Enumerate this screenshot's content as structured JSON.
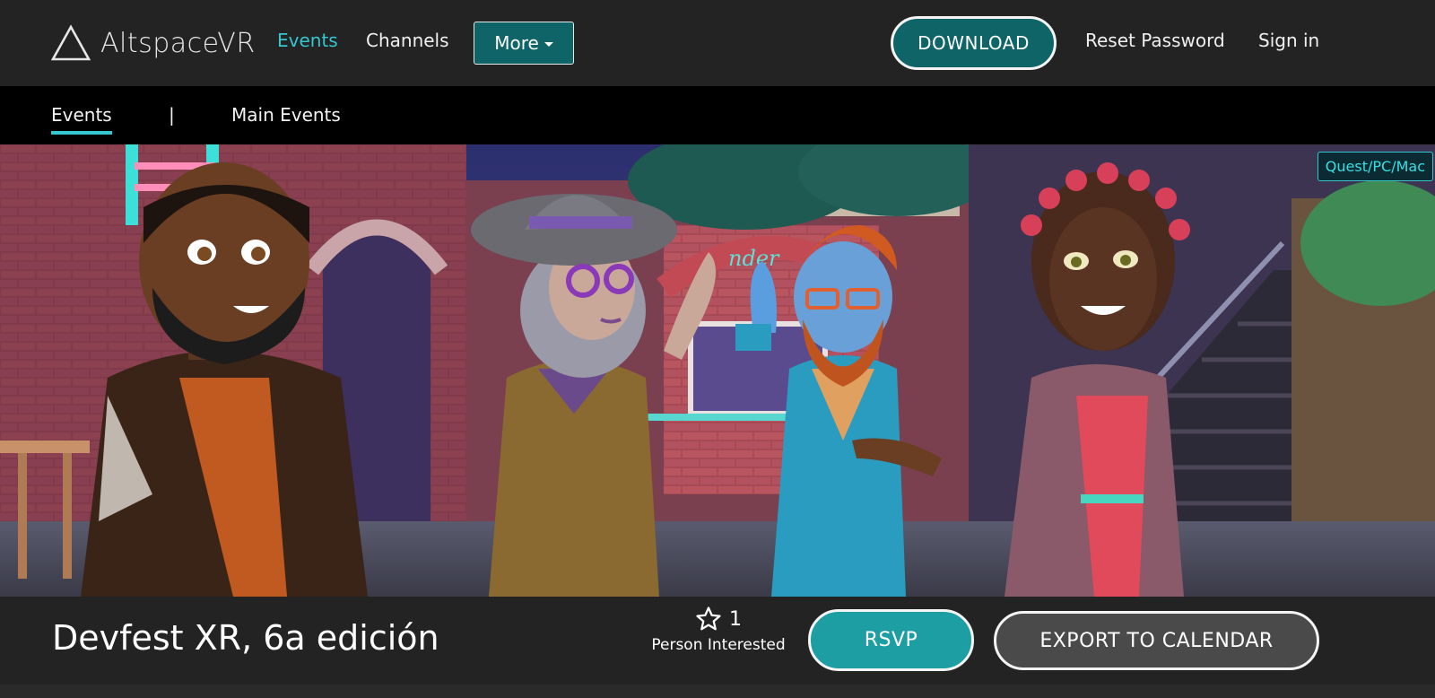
{
  "header": {
    "logo_text": "AltspaceVR",
    "nav": {
      "events": "Events",
      "channels": "Channels",
      "more": "More"
    },
    "download": "DOWNLOAD",
    "reset_password": "Reset Password",
    "sign_in": "Sign in"
  },
  "subnav": {
    "events": "Events",
    "separator": "|",
    "main_events": "Main Events"
  },
  "hero": {
    "platform_badge": "Quest/PC/Mac",
    "sign_text": "nder"
  },
  "event": {
    "title": "Devfest XR, 6a edición",
    "interested_count": "1",
    "interested_label": "Person Interested",
    "rsvp": "RSVP",
    "export": "EXPORT TO CALENDAR"
  },
  "colors": {
    "accent": "#34c7d0",
    "teal_button": "#0e6466",
    "rsvp_button": "#1d9ea3",
    "header_bg": "#232323"
  }
}
